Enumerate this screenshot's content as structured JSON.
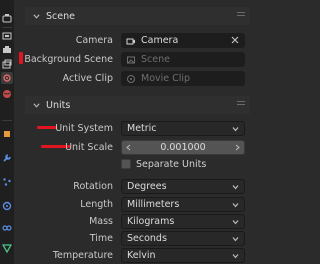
{
  "colors": {
    "marker": "#e0151f",
    "field_bg": "#1d1d1d",
    "panel_bg": "#2b2b2b",
    "accent_number": "#545454"
  },
  "tabs": [
    {
      "name": "tool-tab",
      "icon": "tool-icon"
    },
    {
      "name": "render-tab",
      "icon": "camera-back-icon"
    },
    {
      "name": "output-tab",
      "icon": "printer-icon"
    },
    {
      "name": "view-layer-tab",
      "icon": "image-stack-icon"
    },
    {
      "name": "scene-tab",
      "icon": "scene-icon",
      "active": true
    },
    {
      "name": "world-tab",
      "icon": "world-icon"
    },
    {
      "name": "object-tab",
      "icon": "object-icon"
    },
    {
      "name": "modifiers-tab",
      "icon": "wrench-icon"
    },
    {
      "name": "particles-tab",
      "icon": "particles-icon"
    },
    {
      "name": "physics-tab",
      "icon": "physics-icon"
    },
    {
      "name": "constraints-tab",
      "icon": "constraints-icon"
    },
    {
      "name": "data-tab",
      "icon": "mesh-data-icon"
    }
  ],
  "scene": {
    "header": "Scene",
    "camera_label": "Camera",
    "camera_value": "Camera",
    "background_scene_label": "Background Scene",
    "background_scene_placeholder": "Scene",
    "active_clip_label": "Active Clip",
    "active_clip_placeholder": "Movie Clip"
  },
  "units": {
    "header": "Units",
    "unit_system_label": "Unit System",
    "unit_system_value": "Metric",
    "unit_scale_label": "Unit Scale",
    "unit_scale_value": "0.001000",
    "separate_units_label": "Separate Units",
    "rotation_label": "Rotation",
    "rotation_value": "Degrees",
    "length_label": "Length",
    "length_value": "Millimeters",
    "mass_label": "Mass",
    "mass_value": "Kilograms",
    "time_label": "Time",
    "time_value": "Seconds",
    "temperature_label": "Temperature",
    "temperature_value": "Kelvin"
  }
}
